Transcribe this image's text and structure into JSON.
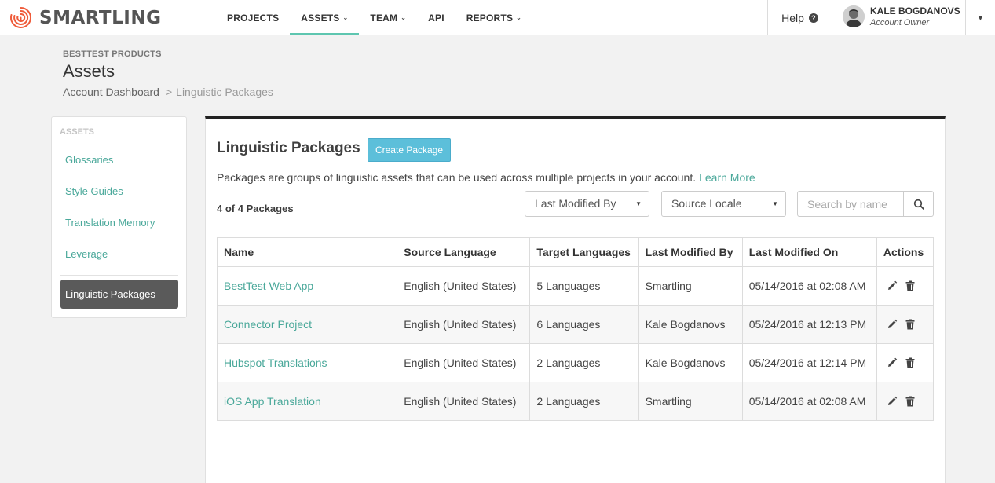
{
  "brand": {
    "name": "SMARTLING",
    "accent": "#5ec6b0",
    "logo_color": "#ef5b3a"
  },
  "nav": {
    "items": [
      {
        "label": "PROJECTS",
        "dropdown": false,
        "active": false
      },
      {
        "label": "ASSETS",
        "dropdown": true,
        "active": true
      },
      {
        "label": "TEAM",
        "dropdown": true,
        "active": false
      },
      {
        "label": "API",
        "dropdown": false,
        "active": false
      },
      {
        "label": "REPORTS",
        "dropdown": true,
        "active": false
      }
    ],
    "help_label": "Help",
    "help_icon": "question-circle-icon"
  },
  "user": {
    "name": "KALE BOGDANOVS",
    "role": "Account Owner"
  },
  "header": {
    "org": "BESTTEST PRODUCTS",
    "title": "Assets",
    "breadcrumb_link": "Account Dashboard",
    "breadcrumb_sep": ">",
    "breadcrumb_current": "Linguistic Packages"
  },
  "sidebar": {
    "heading": "ASSETS",
    "items": [
      {
        "label": "Glossaries"
      },
      {
        "label": "Style Guides"
      },
      {
        "label": "Translation Memory"
      },
      {
        "label": "Leverage"
      }
    ],
    "active_item": "Linguistic Packages"
  },
  "main": {
    "title": "Linguistic Packages",
    "create_button": "Create Package",
    "description": "Packages are groups of linguistic assets that can be used across multiple projects in your account.",
    "learn_more": "Learn More",
    "count": "4 of 4 Packages",
    "filters": {
      "modified_by": "Last Modified By",
      "source_locale": "Source Locale"
    },
    "search": {
      "placeholder": "Search by name",
      "icon": "search-icon"
    },
    "table": {
      "columns": [
        "Name",
        "Source Language",
        "Target Languages",
        "Last Modified By",
        "Last Modified On",
        "Actions"
      ],
      "rows": [
        {
          "name": "BestTest Web App",
          "source": "English (United States)",
          "targets": "5 Languages",
          "modified_by": "Smartling",
          "modified_on": "05/14/2016 at 02:08 AM"
        },
        {
          "name": "Connector Project",
          "source": "English (United States)",
          "targets": "6 Languages",
          "modified_by": "Kale Bogdanovs",
          "modified_on": "05/24/2016 at 12:13 PM"
        },
        {
          "name": "Hubspot Translations",
          "source": "English (United States)",
          "targets": "2 Languages",
          "modified_by": "Kale Bogdanovs",
          "modified_on": "05/24/2016 at 12:14 PM"
        },
        {
          "name": "iOS App Translation",
          "source": "English (United States)",
          "targets": "2 Languages",
          "modified_by": "Smartling",
          "modified_on": "05/14/2016 at 02:08 AM"
        }
      ],
      "action_icons": [
        "pencil-icon",
        "trash-icon"
      ]
    }
  }
}
